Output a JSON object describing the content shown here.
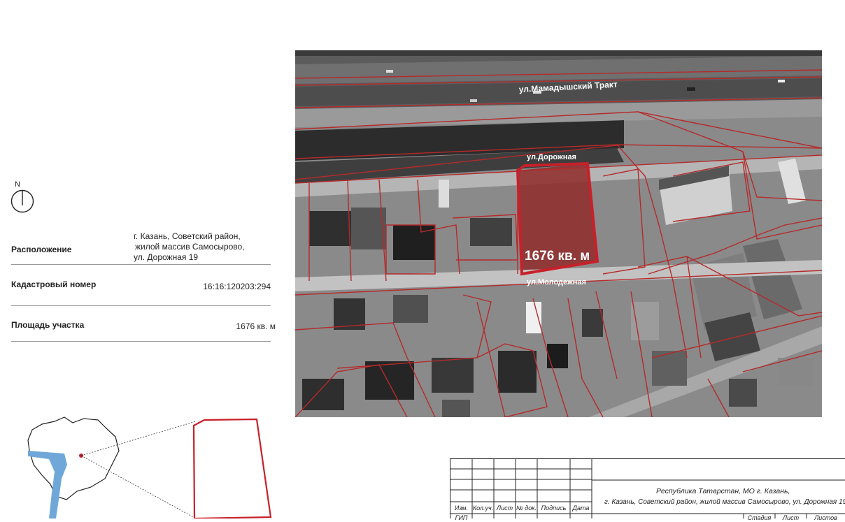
{
  "north": {
    "letter": "N"
  },
  "info": {
    "location_label": "Расположение",
    "location_value": [
      "г. Казань, Советский район,",
      "жилой массив Самосырово,",
      "ул. Дорожная 19"
    ],
    "cadastral_label": "Кадастровый номер",
    "cadastral_value": "16:16:120203:294",
    "area_label": "Площадь участка",
    "area_value": "1676 кв. м"
  },
  "aerial": {
    "street_top": "ул.Мамадышский Тракт",
    "street_mid": "ул.Дорожная",
    "street_bottom": "ул.Молодежная",
    "plot_area": "1676 кв. м"
  },
  "stamp": {
    "headers": [
      "Изм.",
      "Кол.уч.",
      "Лист",
      "№ док.",
      "Подпись",
      "Дата"
    ],
    "project_line1": "Республика Татарстан, МО г. Казань,",
    "project_line2": "г. Казань, Советский район, жилой массив Самосырово, ул. Дорожная 19",
    "bottom_left": "ГИП",
    "bottom_cols": [
      "Стадия",
      "Лист",
      "Листов"
    ]
  },
  "colors": {
    "plot_outline": "#c8202a",
    "cadastral_lines": "#b52a2a"
  }
}
